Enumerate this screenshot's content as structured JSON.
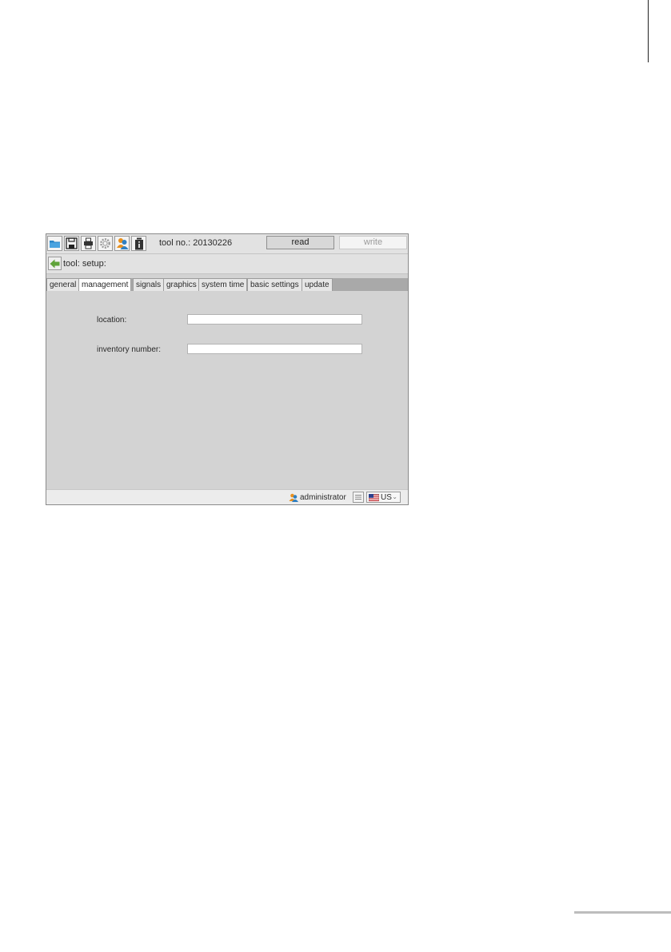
{
  "toolbar": {
    "tool_no_label": "tool no.: 20130226",
    "read_label": "read",
    "write_label": "write",
    "icons": [
      "folder-icon",
      "save-icon",
      "printer-icon",
      "gear-icon",
      "users-icon",
      "info-icon"
    ]
  },
  "breadcrumb": {
    "text": "tool: setup:"
  },
  "tabs": [
    {
      "label": "general",
      "active": false
    },
    {
      "label": "management",
      "active": true
    },
    {
      "label": "signals",
      "active": false
    },
    {
      "label": "graphics",
      "active": false
    },
    {
      "label": "system time",
      "active": false
    },
    {
      "label": "basic settings",
      "active": false
    },
    {
      "label": "update",
      "active": false
    }
  ],
  "form": {
    "location_label": "location:",
    "location_value": "",
    "inventory_label": "inventory number:",
    "inventory_value": ""
  },
  "status": {
    "user": "administrator",
    "language": "US"
  },
  "colors": {
    "content_bg": "#d3d3d3",
    "tabstrip_bg": "#a9a9a9",
    "back_arrow": "#5fa33a",
    "folder": "#2a86c9",
    "user_orange": "#e8901e",
    "user_blue": "#2f7fc1"
  }
}
